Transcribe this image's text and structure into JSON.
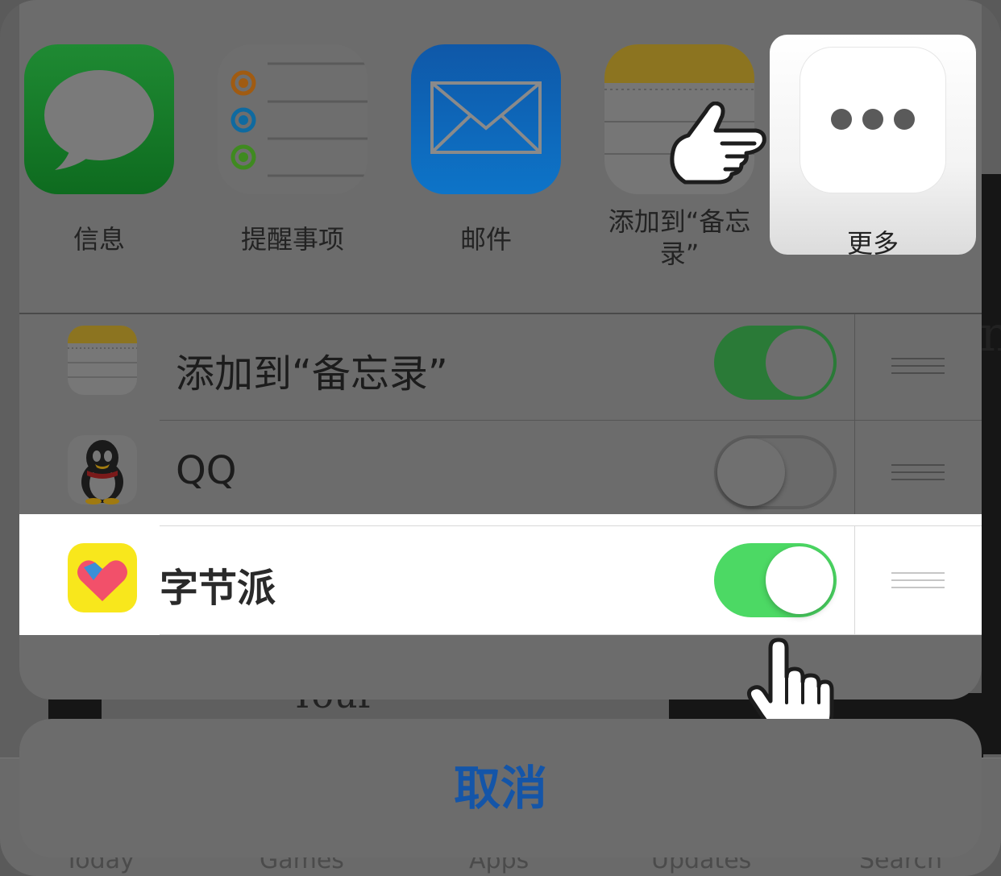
{
  "share_apps": [
    {
      "name": "messages",
      "label": "信息"
    },
    {
      "name": "reminders",
      "label": "提醒事项"
    },
    {
      "name": "mail",
      "label": "邮件"
    },
    {
      "name": "notes",
      "label": "添加到“备忘录”"
    },
    {
      "name": "more",
      "label": "更多"
    }
  ],
  "activity_list": [
    {
      "label": "添加到“备忘录”",
      "enabled": true
    },
    {
      "label": "QQ",
      "enabled": false
    },
    {
      "label": "字节派",
      "enabled": true
    }
  ],
  "cancel_label": "取消",
  "background": {
    "card_text": "Your",
    "side_letter": "n",
    "tabs": [
      "Today",
      "Games",
      "Apps",
      "Updates",
      "Search"
    ]
  },
  "colors": {
    "toggle_on": "#4cd964",
    "toggle_on_dimmed": "#2a7a37",
    "toggle_off_dimmed": "#6a6a6a",
    "cancel_text": "#1455a8",
    "highlight_row": "#ffffff"
  },
  "icons": [
    "speech-bubble-icon",
    "reminders-list-icon",
    "envelope-icon",
    "notes-pad-icon",
    "ellipsis-icon",
    "penguin-icon",
    "heart-logo-icon",
    "pointing-hand-cursor-icon",
    "tap-hand-cursor-icon",
    "drag-handle-icon"
  ]
}
